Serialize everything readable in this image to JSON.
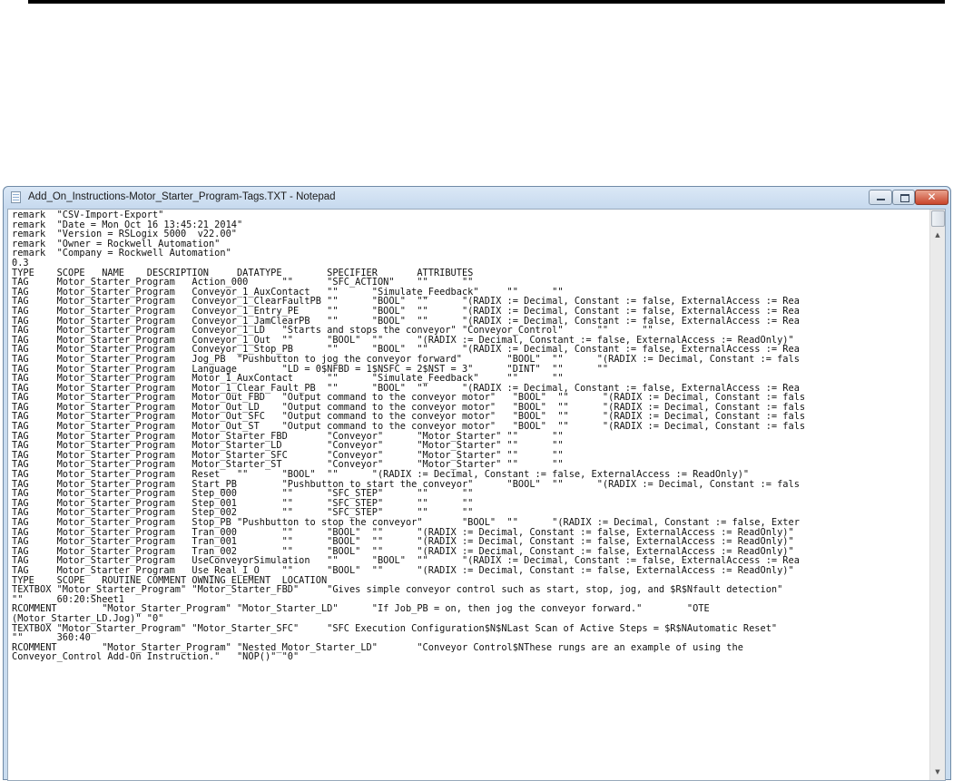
{
  "window": {
    "title": "Add_On_Instructions-Motor_Starter_Program-Tags.TXT - Notepad",
    "accent": "#c9dcef",
    "close_color": "#c8442b",
    "buttons": {
      "minimize_icon": "minimize-icon",
      "maximize_icon": "maximize-icon",
      "close_icon": "close-icon",
      "close_glyph": "✕"
    }
  },
  "editor": {
    "lines": [
      "remark  \"CSV-Import-Export\"",
      "remark  \"Date = Mon Oct 16 13:45:21 2014\"",
      "remark  \"Version = RSLogix 5000  v22.00\"",
      "remark  \"Owner = Rockwell Automation\"",
      "remark  \"Company = Rockwell Automation\"",
      "0.3",
      "TYPE    SCOPE   NAME    DESCRIPTION     DATATYPE        SPECIFIER       ATTRIBUTES",
      "TAG     Motor_Starter_Program   Action_000      \"\"      \"SFC_ACTION\"    \"\"      \"\"",
      "TAG     Motor_Starter_Program   Conveyor_1_AuxContact   \"\"      \"Simulate_Feedback\"     \"\"      \"\"",
      "TAG     Motor_Starter_Program   Conveyor_1_ClearFaultPB \"\"      \"BOOL\"  \"\"      \"(RADIX := Decimal, Constant := false, ExternalAccess := Rea",
      "TAG     Motor_Starter_Program   Conveyor_1_Entry_PE     \"\"      \"BOOL\"  \"\"      \"(RADIX := Decimal, Constant := false, ExternalAccess := Rea",
      "TAG     Motor_Starter_Program   Conveyor_1_JamClearPB   \"\"      \"BOOL\"  \"\"      \"(RADIX := Decimal, Constant := false, ExternalAccess := Rea",
      "TAG     Motor_Starter_Program   Conveyor_1_LD   \"Starts and stops the conveyor\" \"Conveyor_Control\"      \"\"      \"\"",
      "TAG     Motor_Starter_Program   Conveyor_1_Out  \"\"      \"BOOL\"  \"\"      \"(RADIX := Decimal, Constant := false, ExternalAccess := ReadOnly)\"",
      "TAG     Motor_Starter_Program   Conveyor_1_Stop_PB      \"\"      \"BOOL\"  \"\"      \"(RADIX := Decimal, Constant := false, ExternalAccess := Rea",
      "TAG     Motor_Starter_Program   Jog_PB  \"Pushbutton to jog the conveyor forward\"        \"BOOL\"  \"\"      \"(RADIX := Decimal, Constant := fals",
      "TAG     Motor_Starter_Program   Language        \"LD = 0$NFBD = 1$NSFC = 2$NST = 3\"      \"DINT\"  \"\"      \"\"",
      "TAG     Motor_Starter_Program   Motor_1_AuxContact      \"\"      \"Simulate_Feedback\"     \"\"      \"\"",
      "TAG     Motor_Starter_Program   Motor_1_Clear_Fault_PB  \"\"      \"BOOL\"  \"\"      \"(RADIX := Decimal, Constant := false, ExternalAccess := Rea",
      "TAG     Motor_Starter_Program   Motor_Out_FBD   \"Output command to the conveyor motor\"   \"BOOL\"  \"\"      \"(RADIX := Decimal, Constant := fals",
      "TAG     Motor_Starter_Program   Motor_Out_LD    \"Output command to the conveyor motor\"   \"BOOL\"  \"\"      \"(RADIX := Decimal, Constant := fals",
      "TAG     Motor_Starter_Program   Motor_Out_SFC   \"Output command to the conveyor motor\"   \"BOOL\"  \"\"      \"(RADIX := Decimal, Constant := fals",
      "TAG     Motor_Starter_Program   Motor_Out_ST    \"Output command to the conveyor motor\"   \"BOOL\"  \"\"      \"(RADIX := Decimal, Constant := fals",
      "TAG     Motor_Starter_Program   Motor_Starter_FBD       \"Conveyor\"      \"Motor_Starter\" \"\"      \"\"",
      "TAG     Motor_Starter_Program   Motor_Starter_LD        \"Conveyor\"      \"Motor_Starter\" \"\"      \"\"",
      "TAG     Motor_Starter_Program   Motor_Starter_SFC       \"Conveyor\"      \"Motor_Starter\" \"\"      \"\"",
      "TAG     Motor_Starter_Program   Motor_Starter_ST        \"Conveyor\"      \"Motor_Starter\" \"\"      \"\"",
      "TAG     Motor_Starter_Program   Reset   \"\"      \"BOOL\"  \"\"      \"(RADIX := Decimal, Constant := false, ExternalAccess := ReadOnly)\"",
      "TAG     Motor_Starter_Program   Start_PB        \"Pushbutton to start the conveyor\"      \"BOOL\"  \"\"      \"(RADIX := Decimal, Constant := fals",
      "TAG     Motor_Starter_Program   Step_000        \"\"      \"SFC_STEP\"      \"\"      \"\"",
      "TAG     Motor_Starter_Program   Step_001        \"\"      \"SFC_STEP\"      \"\"      \"\"",
      "TAG     Motor_Starter_Program   Step_002        \"\"      \"SFC_STEP\"      \"\"      \"\"",
      "TAG     Motor_Starter_Program   Stop_PB \"Pushbutton to stop the conveyor\"       \"BOOL\"  \"\"      \"(RADIX := Decimal, Constant := false, Exter",
      "TAG     Motor_Starter_Program   Tran_000        \"\"      \"BOOL\"  \"\"      \"(RADIX := Decimal, Constant := false, ExternalAccess := ReadOnly)\"",
      "TAG     Motor_Starter_Program   Tran_001        \"\"      \"BOOL\"  \"\"      \"(RADIX := Decimal, Constant := false, ExternalAccess := ReadOnly)\"",
      "TAG     Motor_Starter_Program   Tran_002        \"\"      \"BOOL\"  \"\"      \"(RADIX := Decimal, Constant := false, ExternalAccess := ReadOnly)\"",
      "TAG     Motor_Starter_Program   UseConveyorSimulation   \"\"      \"BOOL\"  \"\"      \"(RADIX := Decimal, Constant := false, ExternalAccess := Rea",
      "TAG     Motor_Starter_Program   Use_Real_I_O    \"\"      \"BOOL\"  \"\"      \"(RADIX := Decimal, Constant := false, ExternalAccess := ReadOnly)\"",
      "TYPE    SCOPE   ROUTINE COMMENT OWNING_ELEMENT  LOCATION",
      "TEXTBOX \"Motor_Starter_Program\" \"Motor_Starter_FBD\"     \"Gives simple conveyor control such as start, stop, jog, and $R$Nfault detection\"",
      "\"\"      60:20:Sheet1",
      "RCOMMENT        \"Motor_Starter_Program\" \"Motor_Starter_LD\"      \"If Job_PB = on, then jog the conveyor forward.\"        \"OTE",
      "(Motor_Starter_LD.Jog)\" \"0\"",
      "TEXTBOX \"Motor_Starter_Program\" \"Motor_Starter_SFC\"     \"SFC Execution Configuration$N$NLast Scan of Active Steps = $R$NAutomatic Reset\"",
      "\"\"      360:40",
      "RCOMMENT        \"Motor_Starter_Program\" \"Nested_Motor_Starter_LD\"       \"Conveyor Control$NThese rungs are an example of using the",
      "Conveyor_Control Add-On Instruction.\"   \"NOP()\" \"0\""
    ]
  },
  "scrollbar": {
    "up_glyph": "▲",
    "down_glyph": "▼"
  }
}
